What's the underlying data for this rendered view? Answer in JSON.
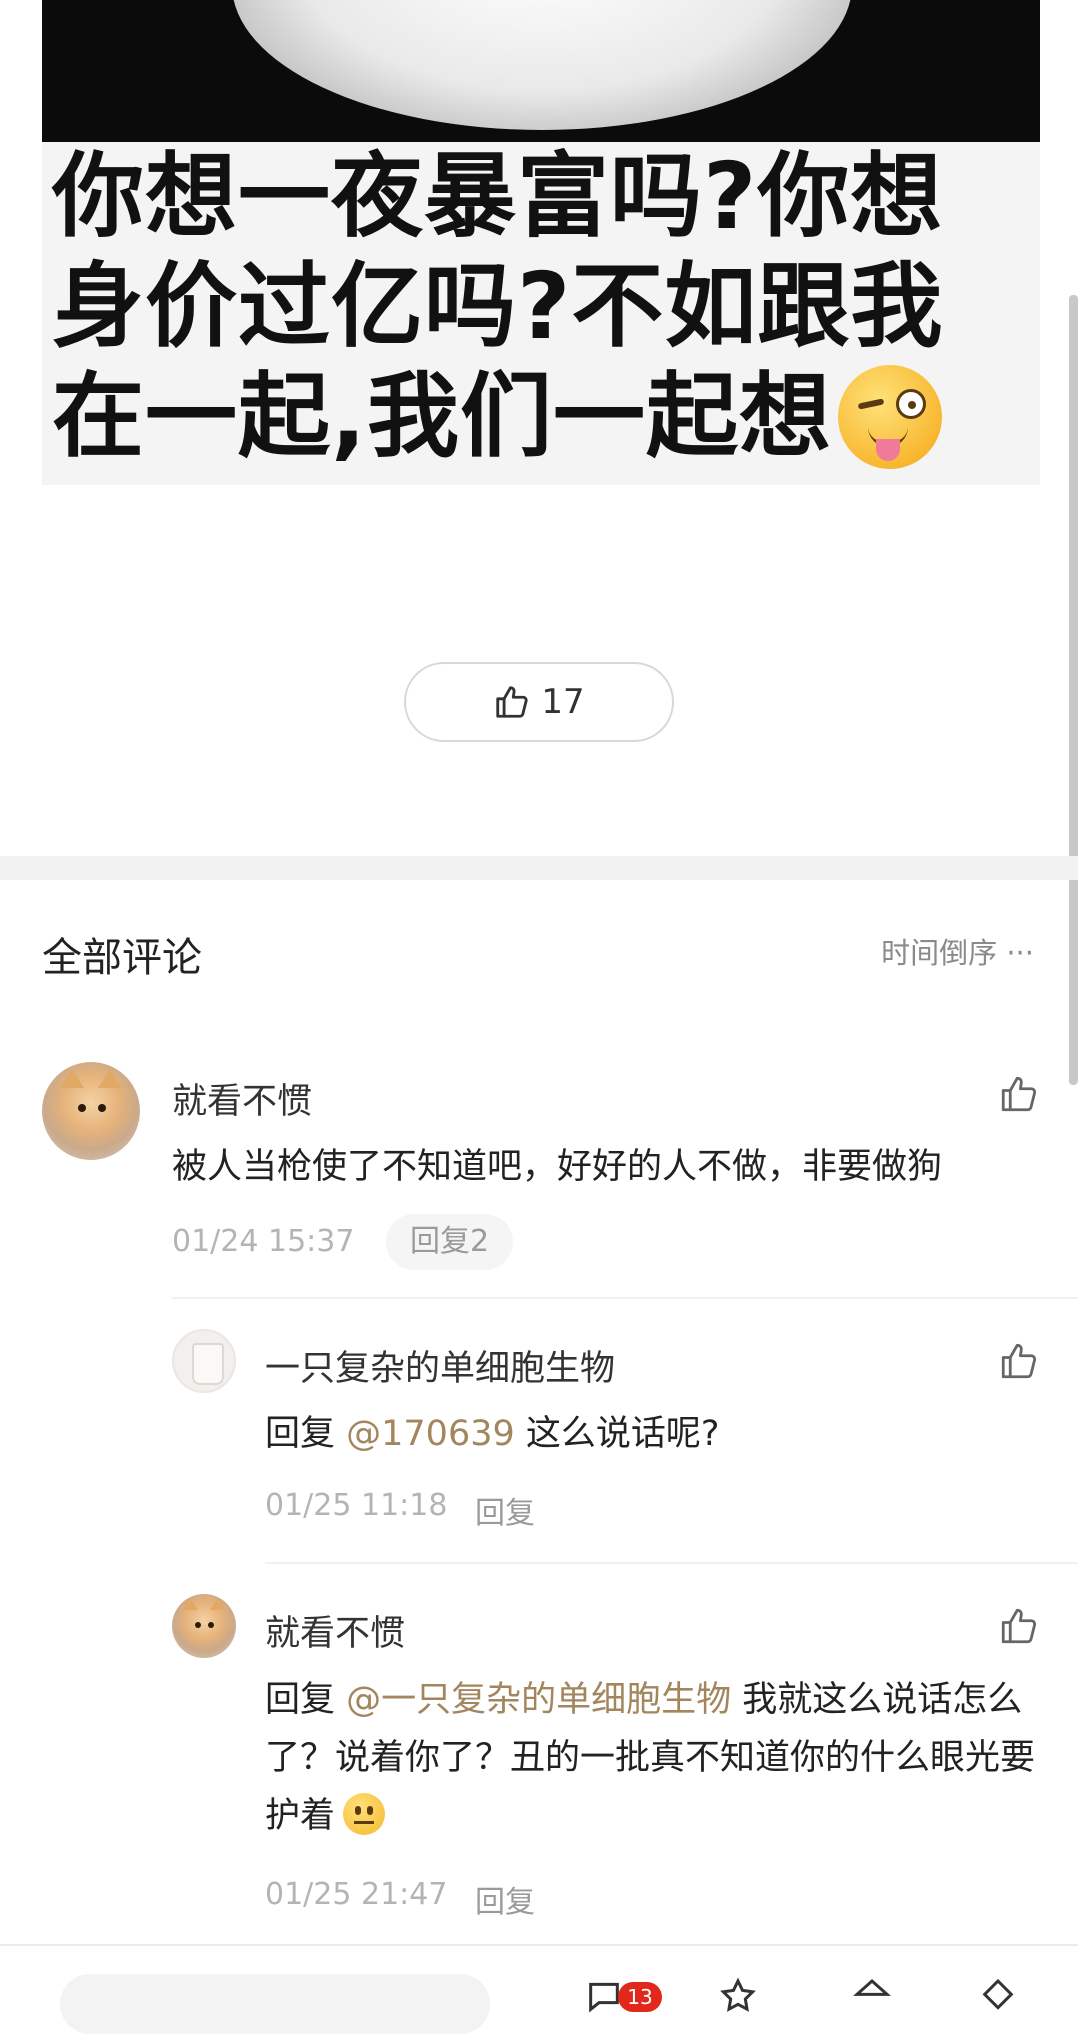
{
  "post": {
    "image_caption_lines": [
      "你想一夜暴富吗?你想",
      "身价过亿吗?不如跟我",
      "在一起,我们一起想"
    ],
    "image_emoji": "wink-tongue-emoji",
    "like_count": "17"
  },
  "comments_section": {
    "title": "全部评论",
    "sort_label": "时间倒序 ···"
  },
  "comments": [
    {
      "author": "就看不惯",
      "text": "被人当枪使了不知道吧，好好的人不做，非要做狗",
      "time": "01/24 15:37",
      "reply_count_label": "回复2"
    }
  ],
  "replies": [
    {
      "author": "一只复杂的单细胞生物",
      "prefix": "回复 ",
      "mention": "@170639",
      "text": " 这么说话呢?",
      "time": "01/25 11:18",
      "reply_label": "回复"
    },
    {
      "author": "就看不惯",
      "prefix": "回复 ",
      "mention": "@一只复杂的单细胞生物",
      "text": " 我就这么说话怎么了？说着你了？丑的一批真不知道你的什么眼光要护着",
      "time": "01/25 21:47",
      "reply_label": "回复"
    }
  ],
  "bottom_bar": {
    "badge_count": "13"
  },
  "colors": {
    "mention": "#a3865e",
    "badge": "#e2281b",
    "meta": "#b4b4b4"
  }
}
